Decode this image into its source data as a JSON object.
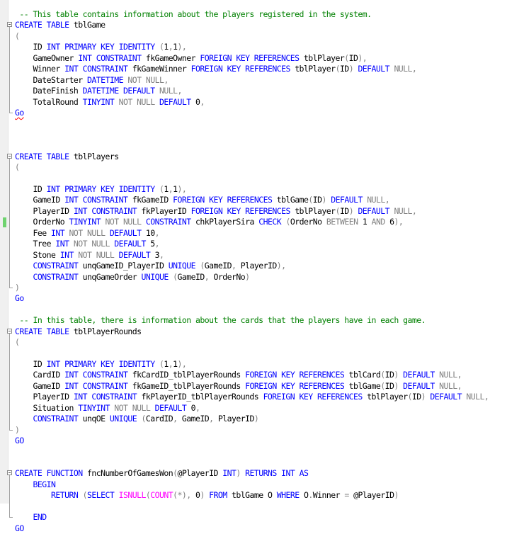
{
  "editor": {
    "language": "T-SQL",
    "colors": {
      "keyword": "#0000ff",
      "function": "#ff00ff",
      "operator": "#808080",
      "comment": "#008000",
      "identifier": "#000000",
      "changed_marker": "#6fd36f"
    },
    "lines": [
      {
        "fold": "",
        "marker": "",
        "tokens": [
          [
            "cm",
            " -- This table contains information about the players registered in the system."
          ]
        ]
      },
      {
        "fold": "start",
        "marker": "",
        "tokens": [
          [
            "kw",
            "CREATE TABLE "
          ],
          [
            "id",
            "tblGame"
          ]
        ]
      },
      {
        "fold": "in",
        "marker": "",
        "tokens": [
          [
            "gr",
            "("
          ]
        ]
      },
      {
        "fold": "in",
        "marker": "",
        "tokens": [
          [
            "id",
            "    ID "
          ],
          [
            "kw",
            "INT PRIMARY KEY IDENTITY "
          ],
          [
            "gr",
            "("
          ],
          [
            "id",
            "1"
          ],
          [
            "gr",
            ","
          ],
          [
            "id",
            "1"
          ],
          [
            "gr",
            "),"
          ]
        ]
      },
      {
        "fold": "in",
        "marker": "",
        "tokens": [
          [
            "id",
            "    GameOwner "
          ],
          [
            "kw",
            "INT CONSTRAINT "
          ],
          [
            "id",
            "fkGameOwner "
          ],
          [
            "kw",
            "FOREIGN KEY REFERENCES "
          ],
          [
            "id",
            "tblPlayer"
          ],
          [
            "gr",
            "("
          ],
          [
            "id",
            "ID"
          ],
          [
            "gr",
            "),"
          ]
        ]
      },
      {
        "fold": "in",
        "marker": "",
        "tokens": [
          [
            "id",
            "    Winner "
          ],
          [
            "kw",
            "INT CONSTRAINT "
          ],
          [
            "id",
            "fkGameWinner "
          ],
          [
            "kw",
            "FOREIGN KEY REFERENCES "
          ],
          [
            "id",
            "tblPlayer"
          ],
          [
            "gr",
            "("
          ],
          [
            "id",
            "ID"
          ],
          [
            "gr",
            ") "
          ],
          [
            "kw",
            "DEFAULT "
          ],
          [
            "gr",
            "NULL,"
          ]
        ]
      },
      {
        "fold": "in",
        "marker": "",
        "tokens": [
          [
            "id",
            "    DateStarter "
          ],
          [
            "kw",
            "DATETIME "
          ],
          [
            "gr",
            "NOT NULL,"
          ]
        ]
      },
      {
        "fold": "in",
        "marker": "",
        "tokens": [
          [
            "id",
            "    DateFinish "
          ],
          [
            "kw",
            "DATETIME DEFAULT "
          ],
          [
            "gr",
            "NULL,"
          ]
        ]
      },
      {
        "fold": "in",
        "marker": "",
        "tokens": [
          [
            "id",
            "    TotalRound "
          ],
          [
            "kw",
            "TINYINT "
          ],
          [
            "gr",
            "NOT NULL "
          ],
          [
            "kw",
            "DEFAULT "
          ],
          [
            "id",
            "0"
          ],
          [
            "gr",
            ","
          ]
        ]
      },
      {
        "fold": "end",
        "marker": "",
        "tokens": [
          [
            "sq",
            "Go"
          ]
        ]
      },
      {
        "fold": "",
        "marker": "",
        "tokens": []
      },
      {
        "fold": "",
        "marker": "",
        "tokens": []
      },
      {
        "fold": "",
        "marker": "",
        "tokens": []
      },
      {
        "fold": "start",
        "marker": "",
        "tokens": [
          [
            "kw",
            "CREATE TABLE "
          ],
          [
            "id",
            "tblPlayers"
          ]
        ]
      },
      {
        "fold": "in",
        "marker": "",
        "tokens": [
          [
            "gr",
            "("
          ]
        ]
      },
      {
        "fold": "in",
        "marker": "",
        "tokens": []
      },
      {
        "fold": "in",
        "marker": "",
        "tokens": [
          [
            "id",
            "    ID "
          ],
          [
            "kw",
            "INT PRIMARY KEY IDENTITY "
          ],
          [
            "gr",
            "("
          ],
          [
            "id",
            "1"
          ],
          [
            "gr",
            ","
          ],
          [
            "id",
            "1"
          ],
          [
            "gr",
            "),"
          ]
        ]
      },
      {
        "fold": "in",
        "marker": "",
        "tokens": [
          [
            "id",
            "    GameID "
          ],
          [
            "kw",
            "INT CONSTRAINT "
          ],
          [
            "id",
            "fkGameID "
          ],
          [
            "kw",
            "FOREIGN KEY REFERENCES "
          ],
          [
            "id",
            "tblGame"
          ],
          [
            "gr",
            "("
          ],
          [
            "id",
            "ID"
          ],
          [
            "gr",
            ") "
          ],
          [
            "kw",
            "DEFAULT "
          ],
          [
            "gr",
            "NULL,"
          ]
        ]
      },
      {
        "fold": "in",
        "marker": "",
        "tokens": [
          [
            "id",
            "    PlayerID "
          ],
          [
            "kw",
            "INT CONSTRAINT "
          ],
          [
            "id",
            "fkPlayerID "
          ],
          [
            "kw",
            "FOREIGN KEY REFERENCES "
          ],
          [
            "id",
            "tblPlayer"
          ],
          [
            "gr",
            "("
          ],
          [
            "id",
            "ID"
          ],
          [
            "gr",
            ") "
          ],
          [
            "kw",
            "DEFAULT "
          ],
          [
            "gr",
            "NULL,"
          ]
        ]
      },
      {
        "fold": "in",
        "marker": "changed",
        "tokens": [
          [
            "id",
            "    OrderNo "
          ],
          [
            "kw",
            "TINYINT "
          ],
          [
            "gr",
            "NOT NULL "
          ],
          [
            "kw",
            "CONSTRAINT "
          ],
          [
            "id",
            "chkPlayerSira "
          ],
          [
            "kw",
            "CHECK "
          ],
          [
            "gr",
            "("
          ],
          [
            "id",
            "OrderNo "
          ],
          [
            "gr",
            "BETWEEN "
          ],
          [
            "id",
            "1 "
          ],
          [
            "gr",
            "AND "
          ],
          [
            "id",
            "6"
          ],
          [
            "gr",
            "),"
          ]
        ]
      },
      {
        "fold": "in",
        "marker": "",
        "tokens": [
          [
            "id",
            "    Fee "
          ],
          [
            "kw",
            "INT "
          ],
          [
            "gr",
            "NOT NULL "
          ],
          [
            "kw",
            "DEFAULT "
          ],
          [
            "id",
            "10"
          ],
          [
            "gr",
            ","
          ]
        ]
      },
      {
        "fold": "in",
        "marker": "",
        "tokens": [
          [
            "id",
            "    Tree "
          ],
          [
            "kw",
            "INT "
          ],
          [
            "gr",
            "NOT NULL "
          ],
          [
            "kw",
            "DEFAULT "
          ],
          [
            "id",
            "5"
          ],
          [
            "gr",
            ","
          ]
        ]
      },
      {
        "fold": "in",
        "marker": "",
        "tokens": [
          [
            "id",
            "    Stone "
          ],
          [
            "kw",
            "INT "
          ],
          [
            "gr",
            "NOT NULL "
          ],
          [
            "kw",
            "DEFAULT "
          ],
          [
            "id",
            "3"
          ],
          [
            "gr",
            ","
          ]
        ]
      },
      {
        "fold": "in",
        "marker": "",
        "tokens": [
          [
            "kw",
            "    CONSTRAINT "
          ],
          [
            "id",
            "unqGameID_PlayerID "
          ],
          [
            "kw",
            "UNIQUE "
          ],
          [
            "gr",
            "("
          ],
          [
            "id",
            "GameID"
          ],
          [
            "gr",
            ", "
          ],
          [
            "id",
            "PlayerID"
          ],
          [
            "gr",
            "),"
          ]
        ]
      },
      {
        "fold": "in",
        "marker": "",
        "tokens": [
          [
            "kw",
            "    CONSTRAINT "
          ],
          [
            "id",
            "unqGameOrder "
          ],
          [
            "kw",
            "UNIQUE "
          ],
          [
            "gr",
            "("
          ],
          [
            "id",
            "GameID"
          ],
          [
            "gr",
            ", "
          ],
          [
            "id",
            "OrderNo"
          ],
          [
            "gr",
            ")"
          ]
        ]
      },
      {
        "fold": "end",
        "marker": "",
        "tokens": [
          [
            "gr",
            ")"
          ]
        ]
      },
      {
        "fold": "",
        "marker": "",
        "tokens": [
          [
            "kw",
            "Go"
          ]
        ]
      },
      {
        "fold": "",
        "marker": "",
        "tokens": []
      },
      {
        "fold": "",
        "marker": "",
        "tokens": [
          [
            "cm",
            " -- In this table, there is information about the cards that the players have in each game."
          ]
        ]
      },
      {
        "fold": "start",
        "marker": "",
        "tokens": [
          [
            "kw",
            "CREATE TABLE "
          ],
          [
            "id",
            "tblPlayerRounds"
          ]
        ]
      },
      {
        "fold": "in",
        "marker": "",
        "tokens": [
          [
            "gr",
            "("
          ]
        ]
      },
      {
        "fold": "in",
        "marker": "",
        "tokens": []
      },
      {
        "fold": "in",
        "marker": "",
        "tokens": [
          [
            "id",
            "    ID "
          ],
          [
            "kw",
            "INT PRIMARY KEY IDENTITY "
          ],
          [
            "gr",
            "("
          ],
          [
            "id",
            "1"
          ],
          [
            "gr",
            ","
          ],
          [
            "id",
            "1"
          ],
          [
            "gr",
            "),"
          ]
        ]
      },
      {
        "fold": "in",
        "marker": "",
        "tokens": [
          [
            "id",
            "    CardID "
          ],
          [
            "kw",
            "INT CONSTRAINT "
          ],
          [
            "id",
            "fkCardID_tblPlayerRounds "
          ],
          [
            "kw",
            "FOREIGN KEY REFERENCES "
          ],
          [
            "id",
            "tblCard"
          ],
          [
            "gr",
            "("
          ],
          [
            "id",
            "ID"
          ],
          [
            "gr",
            ") "
          ],
          [
            "kw",
            "DEFAULT "
          ],
          [
            "gr",
            "NULL,"
          ]
        ]
      },
      {
        "fold": "in",
        "marker": "",
        "tokens": [
          [
            "id",
            "    GameID "
          ],
          [
            "kw",
            "INT CONSTRAINT "
          ],
          [
            "id",
            "fkGameID_tblPlayerRounds "
          ],
          [
            "kw",
            "FOREIGN KEY REFERENCES "
          ],
          [
            "id",
            "tblGame"
          ],
          [
            "gr",
            "("
          ],
          [
            "id",
            "ID"
          ],
          [
            "gr",
            ") "
          ],
          [
            "kw",
            "DEFAULT "
          ],
          [
            "gr",
            "NULL,"
          ]
        ]
      },
      {
        "fold": "in",
        "marker": "",
        "tokens": [
          [
            "id",
            "    PlayerID "
          ],
          [
            "kw",
            "INT CONSTRAINT "
          ],
          [
            "id",
            "fkPlayerID_tblPlayerRounds "
          ],
          [
            "kw",
            "FOREIGN KEY REFERENCES "
          ],
          [
            "id",
            "tblPlayer"
          ],
          [
            "gr",
            "("
          ],
          [
            "id",
            "ID"
          ],
          [
            "gr",
            ") "
          ],
          [
            "kw",
            "DEFAULT "
          ],
          [
            "gr",
            "NULL,"
          ]
        ]
      },
      {
        "fold": "in",
        "marker": "",
        "tokens": [
          [
            "id",
            "    Situation "
          ],
          [
            "kw",
            "TINYINT "
          ],
          [
            "gr",
            "NOT NULL "
          ],
          [
            "kw",
            "DEFAULT "
          ],
          [
            "id",
            "0"
          ],
          [
            "gr",
            ","
          ]
        ]
      },
      {
        "fold": "in",
        "marker": "",
        "tokens": [
          [
            "kw",
            "    CONSTRAINT "
          ],
          [
            "id",
            "unqOE "
          ],
          [
            "kw",
            "UNIQUE "
          ],
          [
            "gr",
            "("
          ],
          [
            "id",
            "CardID"
          ],
          [
            "gr",
            ", "
          ],
          [
            "id",
            "GameID"
          ],
          [
            "gr",
            ", "
          ],
          [
            "id",
            "PlayerID"
          ],
          [
            "gr",
            ")"
          ]
        ]
      },
      {
        "fold": "end",
        "marker": "",
        "tokens": [
          [
            "gr",
            ")"
          ]
        ]
      },
      {
        "fold": "",
        "marker": "",
        "tokens": [
          [
            "kw",
            "GO"
          ]
        ]
      },
      {
        "fold": "",
        "marker": "",
        "tokens": []
      },
      {
        "fold": "",
        "marker": "",
        "tokens": []
      },
      {
        "fold": "start",
        "marker": "",
        "tokens": [
          [
            "kw",
            "CREATE FUNCTION "
          ],
          [
            "id",
            "fncNumberOfGamesWon"
          ],
          [
            "gr",
            "("
          ],
          [
            "id",
            "@PlayerID "
          ],
          [
            "kw",
            "INT"
          ],
          [
            "gr",
            ") "
          ],
          [
            "kw",
            "RETURNS INT AS"
          ]
        ]
      },
      {
        "fold": "in",
        "marker": "",
        "tokens": [
          [
            "kw",
            "    BEGIN"
          ]
        ]
      },
      {
        "fold": "in",
        "marker": "",
        "tokens": [
          [
            "kw",
            "        RETURN "
          ],
          [
            "gr",
            "("
          ],
          [
            "kw",
            "SELECT "
          ],
          [
            "fn",
            "ISNULL"
          ],
          [
            "gr",
            "("
          ],
          [
            "fn",
            "COUNT"
          ],
          [
            "gr",
            "(*), "
          ],
          [
            "id",
            "0"
          ],
          [
            "gr",
            ") "
          ],
          [
            "kw",
            "FROM "
          ],
          [
            "id",
            "tblGame O "
          ],
          [
            "kw",
            "WHERE "
          ],
          [
            "id",
            "O"
          ],
          [
            "gr",
            "."
          ],
          [
            "id",
            "Winner "
          ],
          [
            "gr",
            "= "
          ],
          [
            "id",
            "@PlayerID"
          ],
          [
            "gr",
            ")"
          ]
        ]
      },
      {
        "fold": "in",
        "marker": "",
        "tokens": []
      },
      {
        "fold": "end",
        "marker": "",
        "tokens": [
          [
            "kw",
            "    END"
          ]
        ]
      },
      {
        "fold": "",
        "marker": "",
        "tokens": [
          [
            "kw",
            "GO"
          ]
        ]
      }
    ]
  }
}
